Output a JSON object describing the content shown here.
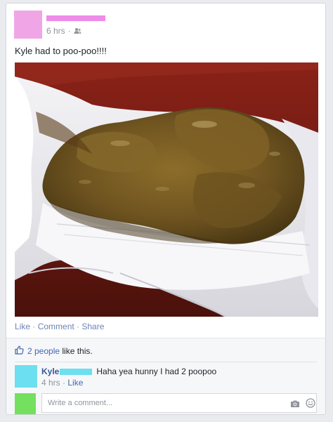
{
  "post": {
    "timestamp": "6 hrs",
    "separator": "·",
    "text": "Kyle had to poo-poo!!!!"
  },
  "actions": {
    "like": "Like",
    "comment": "Comment",
    "share": "Share",
    "sep": " · "
  },
  "likes": {
    "people": "2 people",
    "suffix": " like this."
  },
  "comment": {
    "author_first": "Kyle",
    "text": "Haha yea hunny I had 2 poopoo",
    "timestamp": "4 hrs",
    "sep": " · ",
    "like": "Like"
  },
  "composer": {
    "placeholder": "Write a comment..."
  },
  "colors": {
    "poster_avatar": "#f0a6e6",
    "commenter_avatar": "#6cdff0",
    "self_avatar": "#74e05f",
    "link": "#4267b2"
  },
  "icons": {
    "audience": "friends-icon",
    "like": "thumbs-up-icon",
    "camera": "camera-icon",
    "emoji": "emoji-icon"
  }
}
